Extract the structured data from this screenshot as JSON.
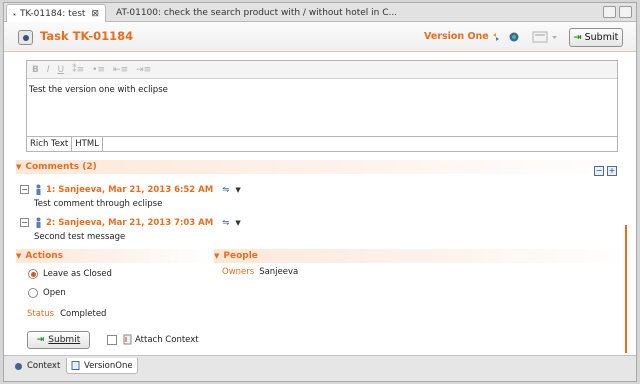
{
  "tabs": [
    {
      "label": "TK-01184: test",
      "close": "⊠",
      "active": true
    },
    {
      "label": "AT-01100: check the search product with / without hotel in C..."
    }
  ],
  "header": {
    "title": "Task TK-01184",
    "repository": "Version One",
    "submit_label": "Submit"
  },
  "editor": {
    "toolbar": [
      "B",
      "I",
      "U"
    ],
    "text": "Test the version one with eclipse",
    "tabs": [
      "Rich Text",
      "HTML"
    ]
  },
  "comments": {
    "header": "Comments (2)",
    "items": [
      {
        "title": "1: Sanjeeva, Mar 21, 2013 6:52 AM",
        "body": "Test comment through eclipse"
      },
      {
        "title": "2: Sanjeeva, Mar 21, 2013 7:03 AM",
        "body": "Second test message"
      }
    ]
  },
  "actions": {
    "header": "Actions",
    "options": [
      {
        "label": "Leave as Closed",
        "selected": true
      },
      {
        "label": "Open",
        "selected": false
      }
    ],
    "status_label": "Status",
    "status_value": "Completed",
    "submit_label": "Submit",
    "attach_context_label": "Attach Context",
    "attach_context_checked": false
  },
  "people": {
    "header": "People",
    "owners_label": "Owners",
    "owners_value": "Sanjeeva"
  },
  "bottom_tabs": [
    {
      "label": "Context",
      "active": false
    },
    {
      "label": "VersionOne",
      "active": true
    }
  ],
  "colors": {
    "accent": "#e96d1f",
    "section_bg": "#fde8d8",
    "submit_arrow": "#2a8a2a"
  }
}
